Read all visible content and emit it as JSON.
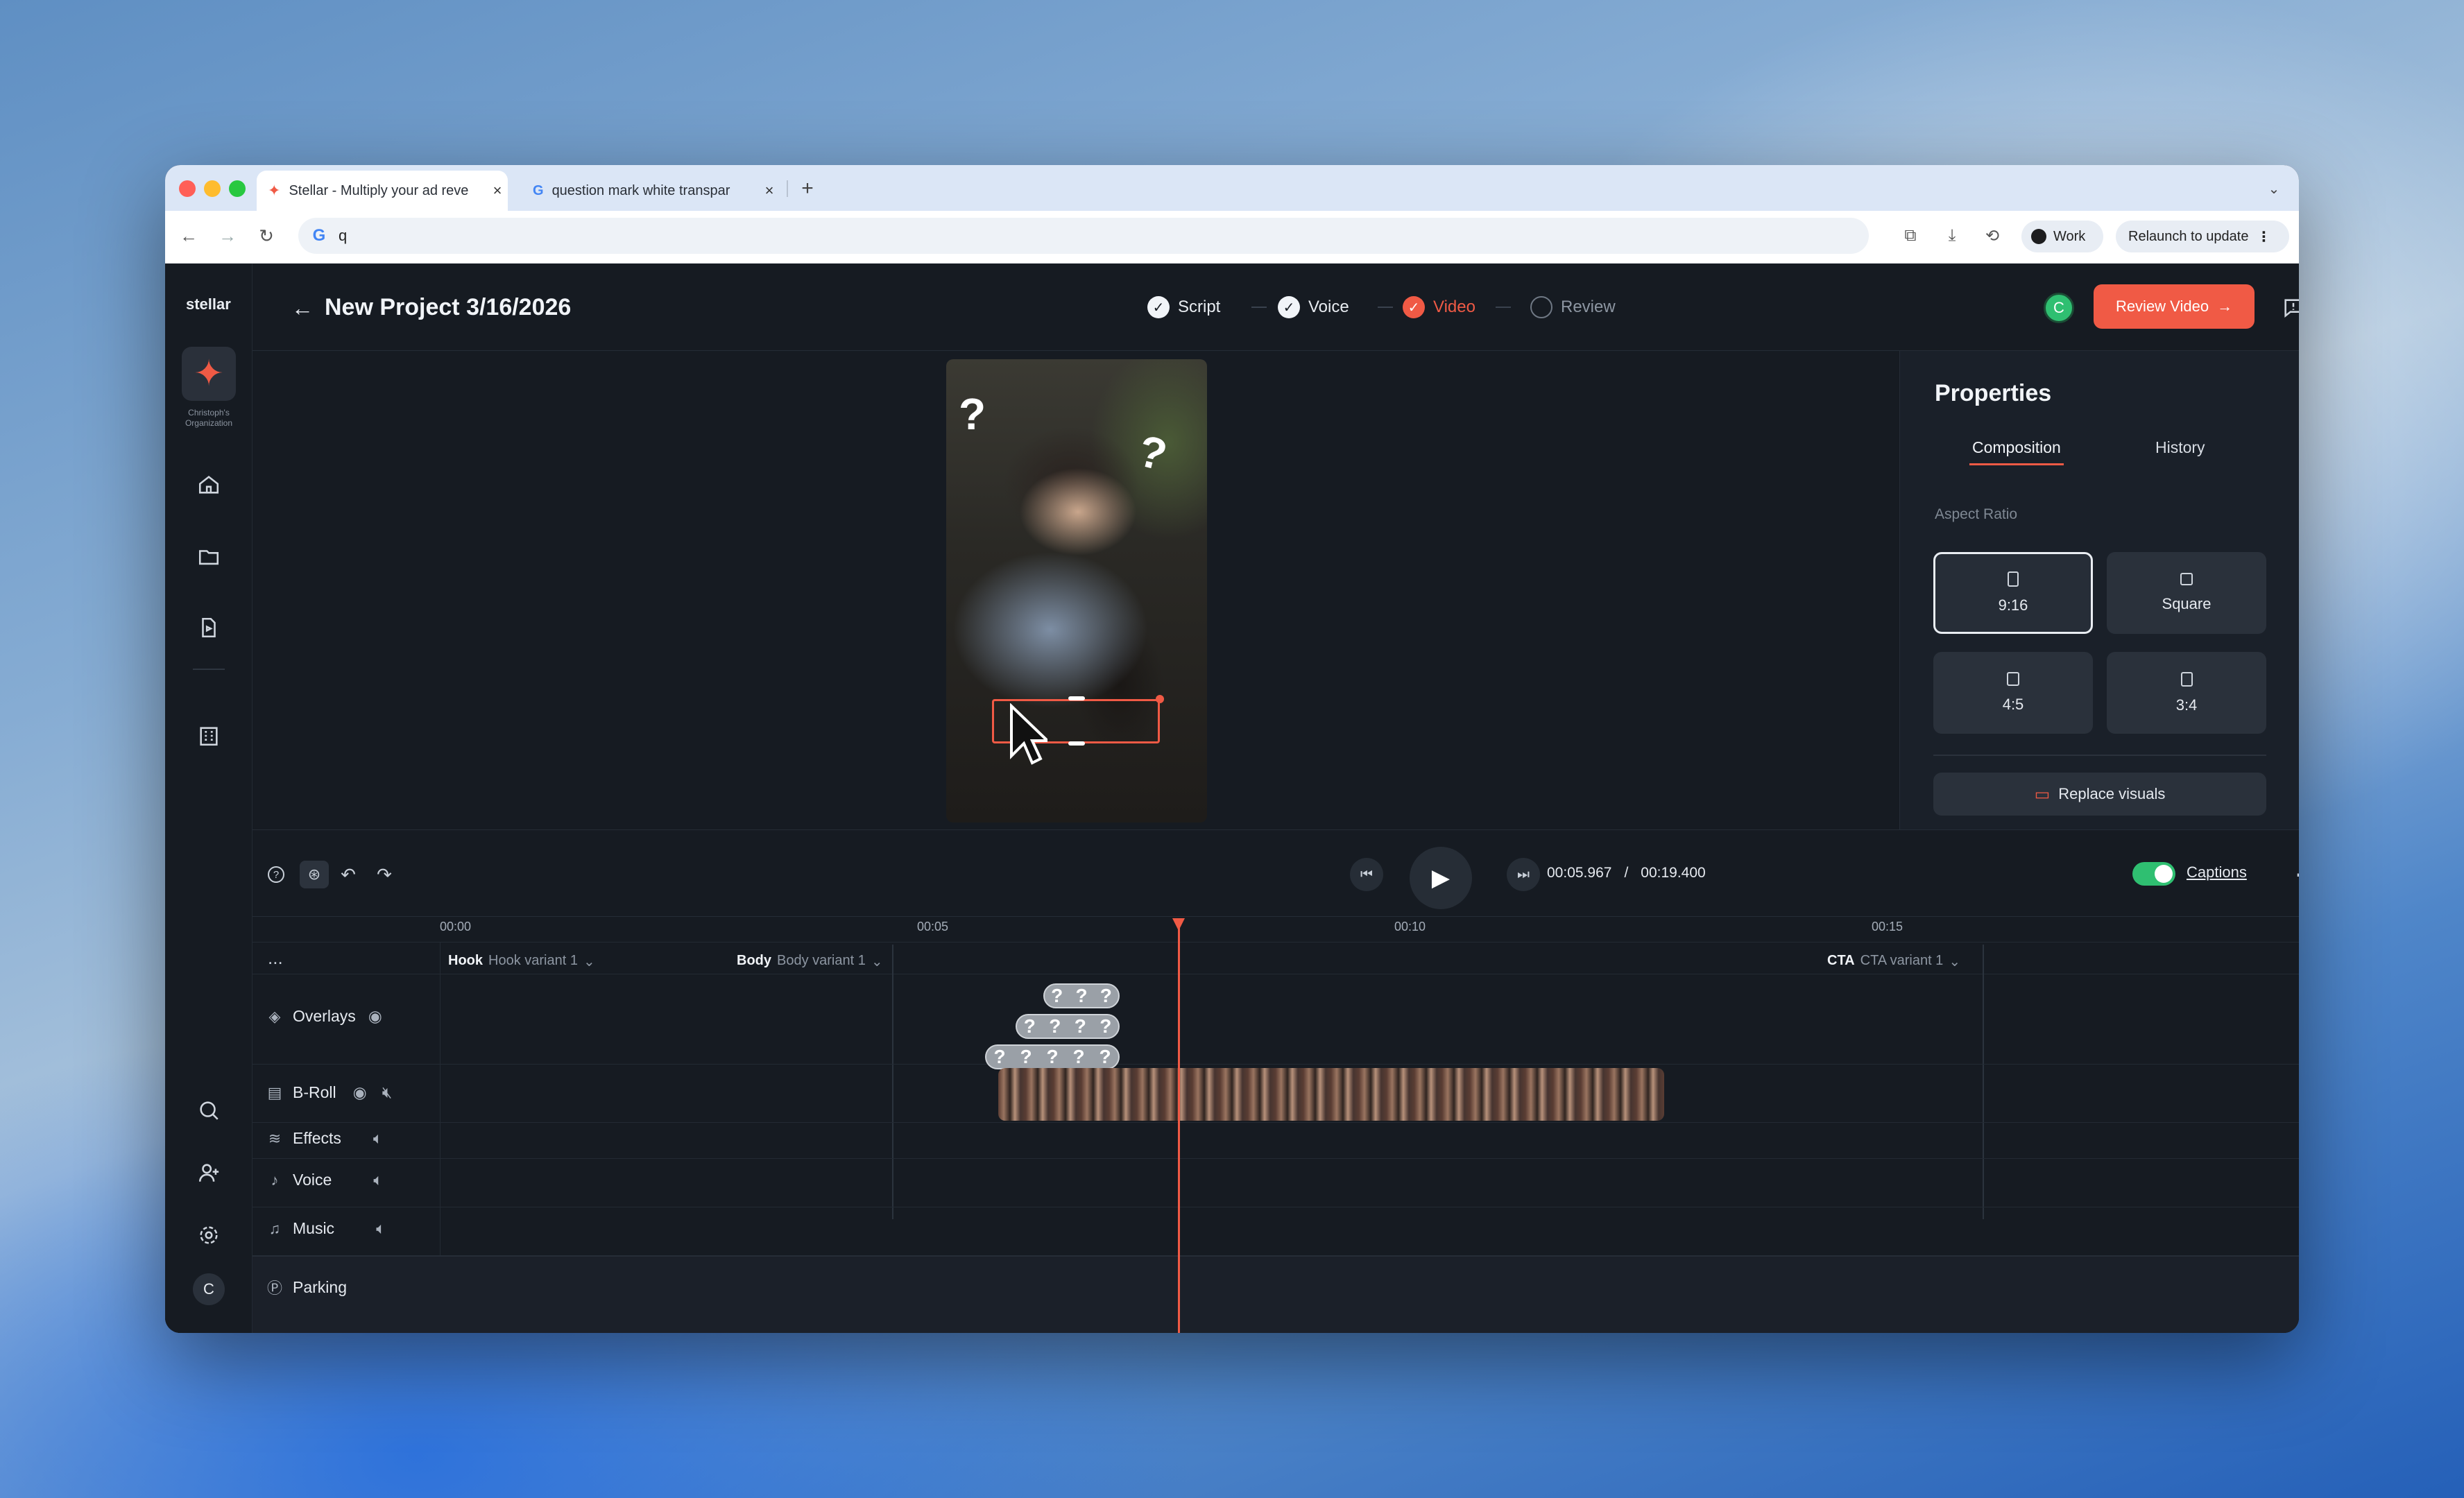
{
  "browser": {
    "tabs": [
      {
        "title": "Stellar - Multiply your ad reve",
        "active": true
      },
      {
        "title": "question mark white transpar",
        "active": false
      }
    ],
    "new_tab": "+",
    "address": "q",
    "profile_label": "Work",
    "relaunch_label": "Relaunch to update"
  },
  "app": {
    "logo": "stellar",
    "org_label": "Christoph's Organization",
    "avatar_letter": "C",
    "project_title": "New Project 3/16/2026",
    "steps": [
      {
        "label": "Script",
        "state": "done"
      },
      {
        "label": "Voice",
        "state": "done"
      },
      {
        "label": "Video",
        "state": "active"
      },
      {
        "label": "Review",
        "state": "todo"
      }
    ],
    "user_avatar": "C",
    "review_button": "Review Video",
    "accent_color": "#f05a45"
  },
  "properties": {
    "title": "Properties",
    "tabs": [
      "Composition",
      "History"
    ],
    "active_tab": "Composition",
    "aspect_ratio_label": "Aspect Ratio",
    "ratios": [
      "9:16",
      "Square",
      "4:5",
      "3:4"
    ],
    "selected_ratio": "9:16",
    "replace_visuals": "Replace visuals"
  },
  "preview": {
    "overlay_marks": [
      "?",
      "?"
    ]
  },
  "playback": {
    "current_time": "00:05.967",
    "separator": "/",
    "total_time": "00:19.400",
    "captions_label": "Captions",
    "captions_on": true
  },
  "timeline": {
    "ruler": [
      "00:00",
      "00:05",
      "00:10",
      "00:15"
    ],
    "menu": "...",
    "sections": [
      {
        "name": "Hook",
        "variant": "Hook variant 1"
      },
      {
        "name": "Body",
        "variant": "Body variant 1"
      },
      {
        "name": "CTA",
        "variant": "CTA variant 1"
      }
    ],
    "tracks": [
      "Overlays",
      "B-Roll",
      "Effects",
      "Voice",
      "Music",
      "Parking"
    ],
    "overlay_clip_marks": [
      "?",
      "?",
      "?",
      "?",
      "?",
      "?",
      "?",
      "?",
      "?",
      "?",
      "?",
      "?"
    ]
  }
}
